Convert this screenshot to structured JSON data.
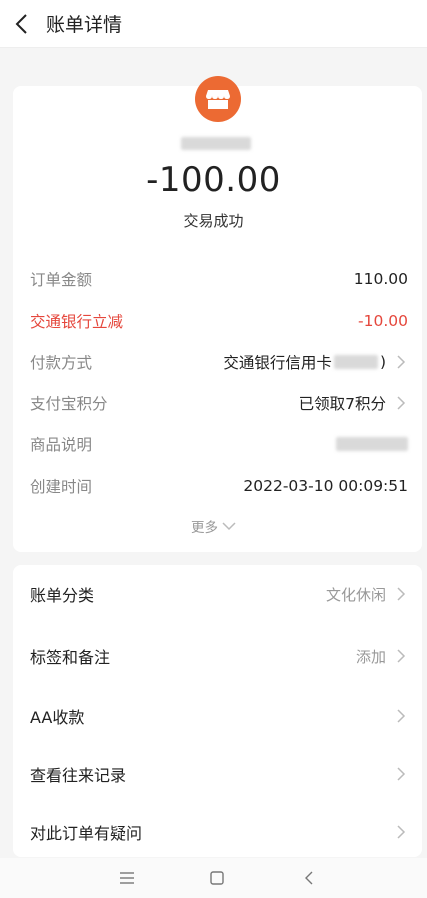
{
  "header": {
    "title": "账单详情"
  },
  "summary": {
    "amount": "-100.00",
    "status": "交易成功",
    "accent_color": "#ec6a33"
  },
  "details": {
    "order_amount_label": "订单金额",
    "order_amount_value": "110.00",
    "discount_label": "交通银行立减",
    "discount_value": "-10.00",
    "payment_label": "付款方式",
    "payment_value_prefix": "交通银行信用卡",
    "payment_value_suffix": ")",
    "points_label": "支付宝积分",
    "points_value": "已领取7积分",
    "product_label": "商品说明",
    "created_label": "创建时间",
    "created_value": "2022-03-10 00:09:51",
    "more_label": "更多"
  },
  "actions": {
    "category_label": "账单分类",
    "category_value": "文化休闲",
    "tags_label": "标签和备注",
    "tags_value": "添加",
    "aa_label": "AA收款",
    "history_label": "查看往来记录",
    "question_label": "对此订单有疑问"
  }
}
